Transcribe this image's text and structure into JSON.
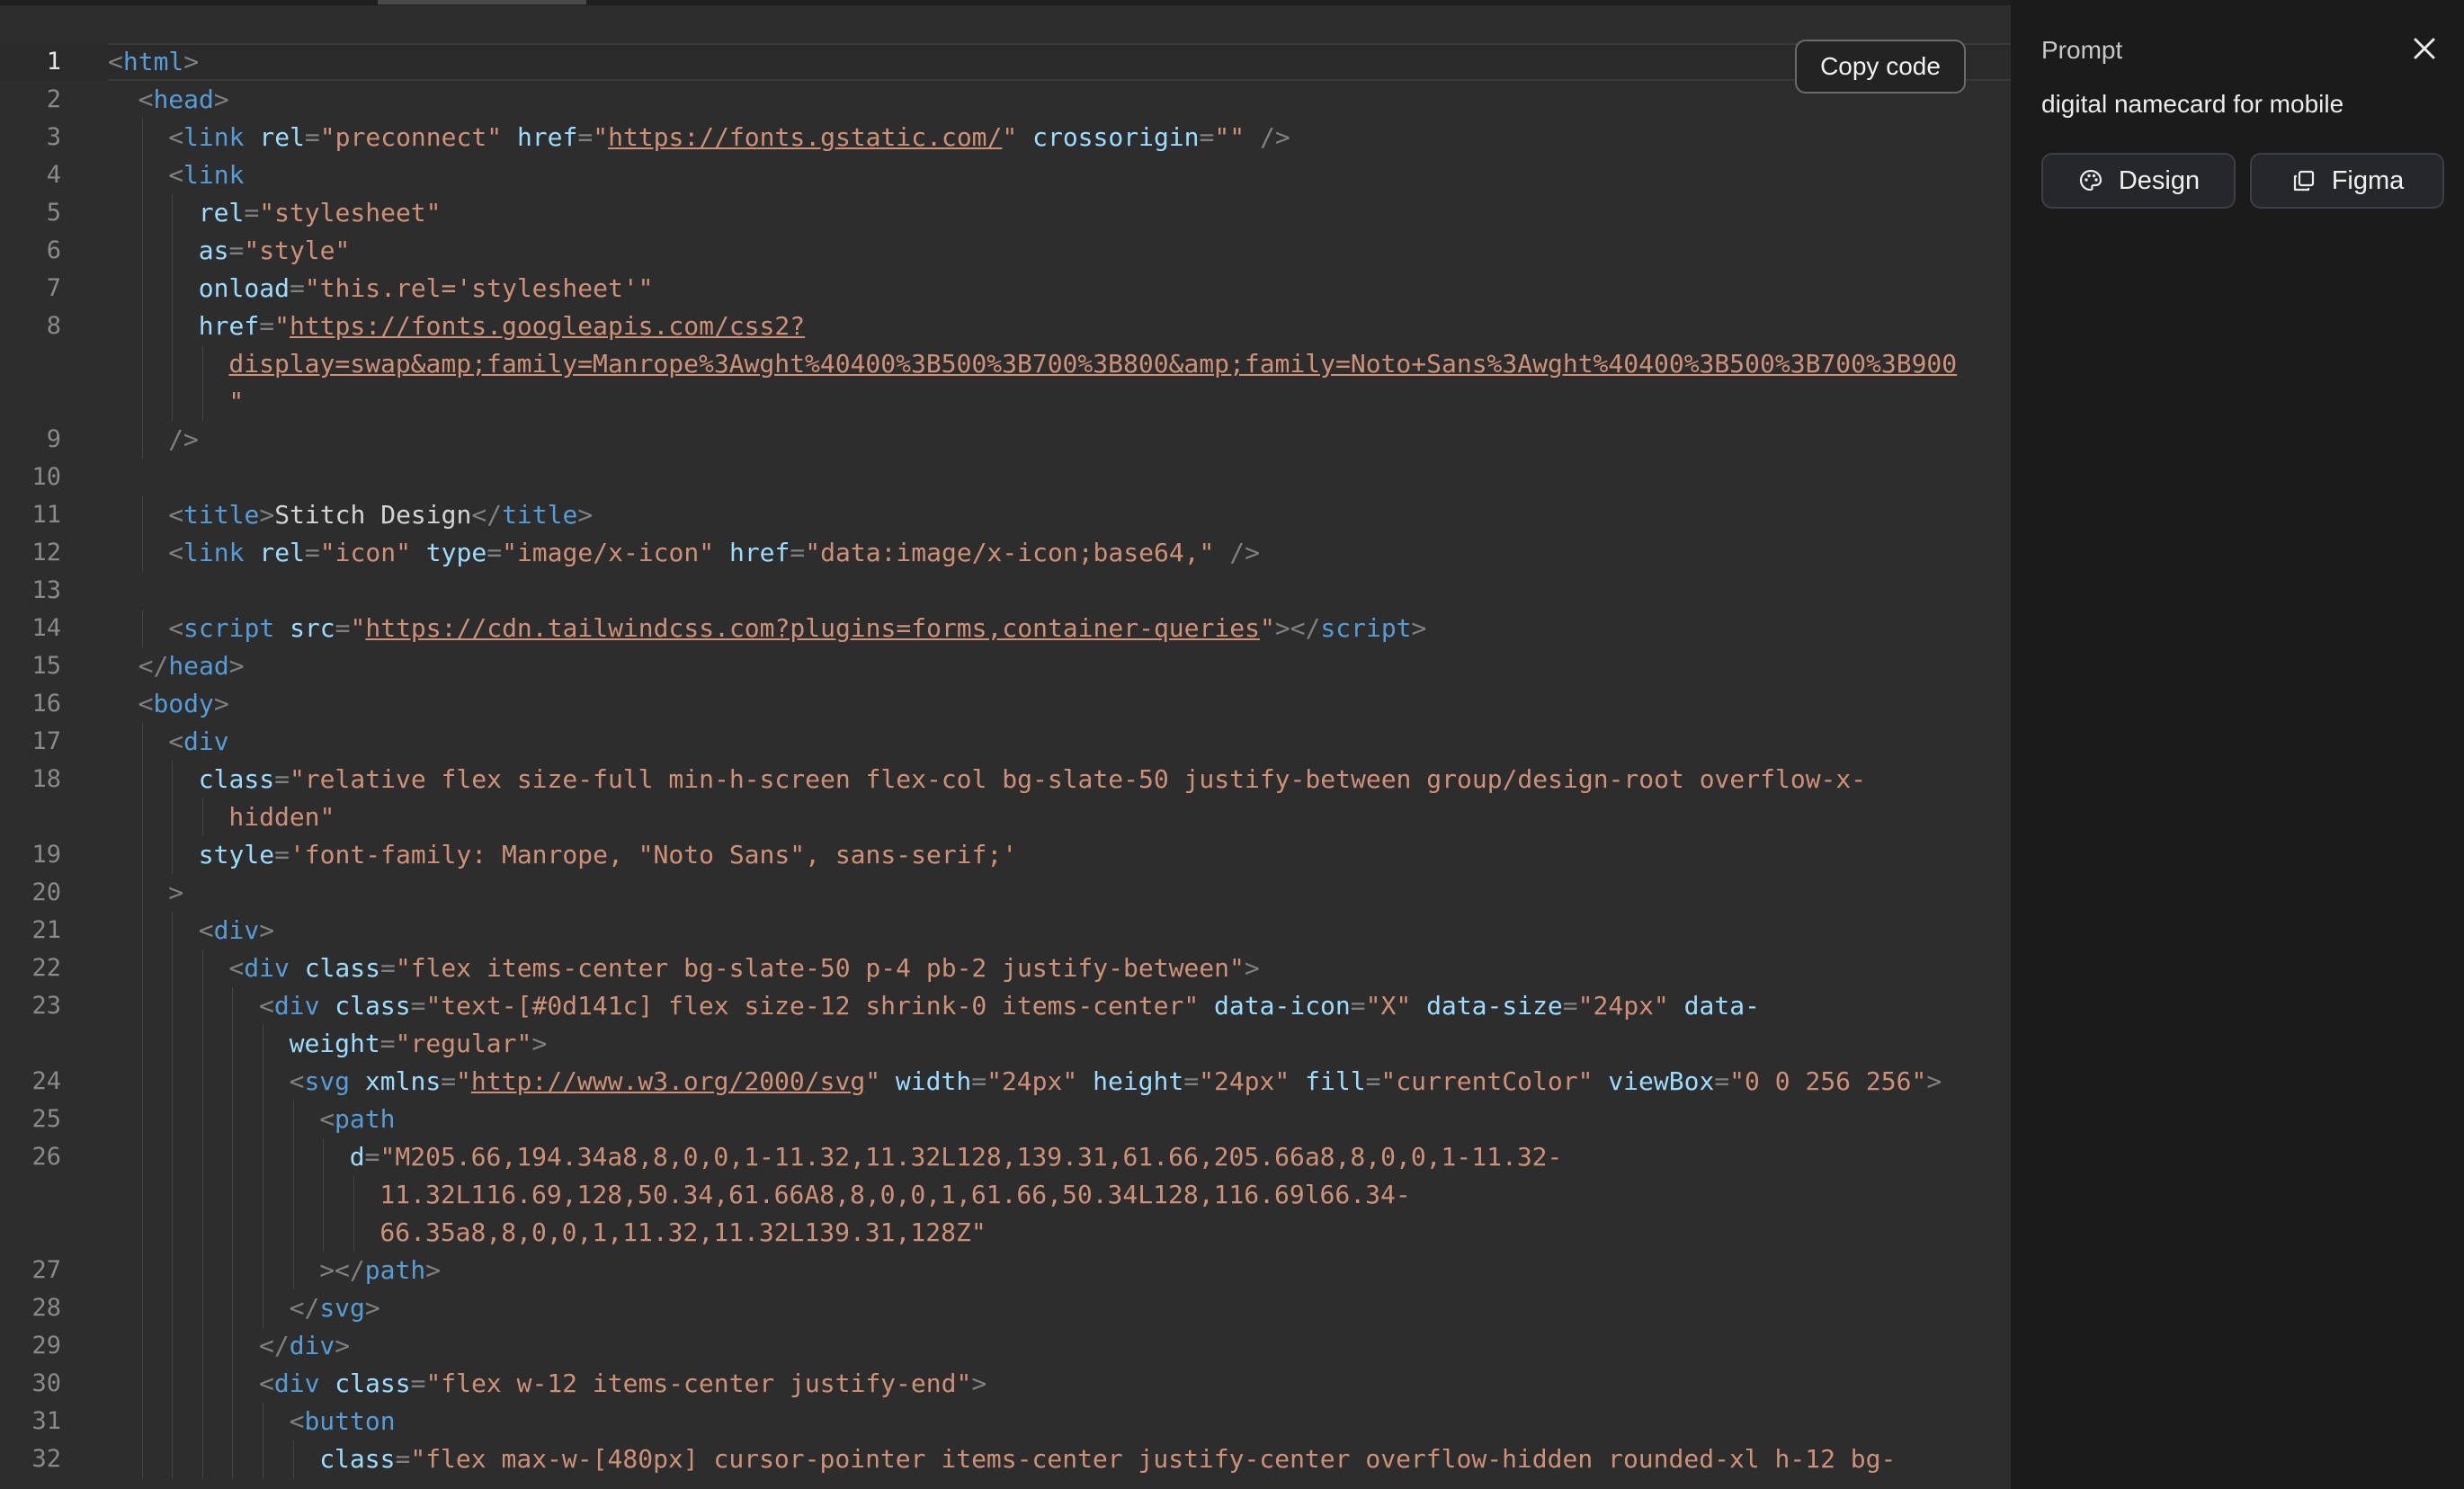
{
  "editor": {
    "copy_label": "Copy code",
    "active_line": 1,
    "lines": [
      {
        "n": "1",
        "indent": 0,
        "t": [
          [
            "tag",
            "<"
          ],
          [
            "name",
            "html"
          ],
          [
            "tag",
            ">"
          ]
        ]
      },
      {
        "n": "2",
        "indent": 1,
        "t": [
          [
            "tag",
            "<"
          ],
          [
            "name",
            "head"
          ],
          [
            "tag",
            ">"
          ]
        ]
      },
      {
        "n": "3",
        "indent": 2,
        "t": [
          [
            "tag",
            "<"
          ],
          [
            "name",
            "link"
          ],
          [
            "p",
            " "
          ],
          [
            "attr",
            "rel"
          ],
          [
            "tag",
            "="
          ],
          [
            "str",
            "\"preconnect\""
          ],
          [
            "p",
            " "
          ],
          [
            "attr",
            "href"
          ],
          [
            "tag",
            "="
          ],
          [
            "str",
            "\""
          ],
          [
            "url",
            "https://fonts.gstatic.com/"
          ],
          [
            "str",
            "\""
          ],
          [
            "p",
            " "
          ],
          [
            "attr",
            "crossorigin"
          ],
          [
            "tag",
            "="
          ],
          [
            "str",
            "\"\""
          ],
          [
            "p",
            " "
          ],
          [
            "tag",
            "/>"
          ]
        ]
      },
      {
        "n": "4",
        "indent": 2,
        "t": [
          [
            "tag",
            "<"
          ],
          [
            "name",
            "link"
          ]
        ]
      },
      {
        "n": "5",
        "indent": 3,
        "t": [
          [
            "attr",
            "rel"
          ],
          [
            "tag",
            "="
          ],
          [
            "str",
            "\"stylesheet\""
          ]
        ]
      },
      {
        "n": "6",
        "indent": 3,
        "t": [
          [
            "attr",
            "as"
          ],
          [
            "tag",
            "="
          ],
          [
            "str",
            "\"style\""
          ]
        ]
      },
      {
        "n": "7",
        "indent": 3,
        "t": [
          [
            "attr",
            "onload"
          ],
          [
            "tag",
            "="
          ],
          [
            "str",
            "\"this.rel='stylesheet'\""
          ]
        ]
      },
      {
        "n": "8",
        "indent": 3,
        "t": [
          [
            "attr",
            "href"
          ],
          [
            "tag",
            "="
          ],
          [
            "str",
            "\""
          ],
          [
            "url",
            "https://fonts.googleapis.com/css2?"
          ]
        ]
      },
      {
        "n": "",
        "indent": 4,
        "t": [
          [
            "url",
            "display=swap&amp;family=Manrope%3Awght%40400%3B500%3B700%3B800&amp;family=Noto+Sans%3Awght%40400%3B500%3B700%3B900"
          ]
        ]
      },
      {
        "n": "",
        "indent": 4,
        "t": [
          [
            "str",
            "\""
          ]
        ]
      },
      {
        "n": "9",
        "indent": 2,
        "t": [
          [
            "tag",
            "/>"
          ]
        ]
      },
      {
        "n": "10",
        "indent": 0,
        "t": []
      },
      {
        "n": "11",
        "indent": 2,
        "t": [
          [
            "tag",
            "<"
          ],
          [
            "name",
            "title"
          ],
          [
            "tag",
            ">"
          ],
          [
            "text",
            "Stitch Design"
          ],
          [
            "tag",
            "</"
          ],
          [
            "name",
            "title"
          ],
          [
            "tag",
            ">"
          ]
        ]
      },
      {
        "n": "12",
        "indent": 2,
        "t": [
          [
            "tag",
            "<"
          ],
          [
            "name",
            "link"
          ],
          [
            "p",
            " "
          ],
          [
            "attr",
            "rel"
          ],
          [
            "tag",
            "="
          ],
          [
            "str",
            "\"icon\""
          ],
          [
            "p",
            " "
          ],
          [
            "attr",
            "type"
          ],
          [
            "tag",
            "="
          ],
          [
            "str",
            "\"image/x-icon\""
          ],
          [
            "p",
            " "
          ],
          [
            "attr",
            "href"
          ],
          [
            "tag",
            "="
          ],
          [
            "str",
            "\"data:image/x-icon;base64,\""
          ],
          [
            "p",
            " "
          ],
          [
            "tag",
            "/>"
          ]
        ]
      },
      {
        "n": "13",
        "indent": 0,
        "t": []
      },
      {
        "n": "14",
        "indent": 2,
        "t": [
          [
            "tag",
            "<"
          ],
          [
            "name",
            "script"
          ],
          [
            "p",
            " "
          ],
          [
            "attr",
            "src"
          ],
          [
            "tag",
            "="
          ],
          [
            "str",
            "\""
          ],
          [
            "url",
            "https://cdn.tailwindcss.com?plugins=forms,container-queries"
          ],
          [
            "str",
            "\""
          ],
          [
            "tag",
            "></"
          ],
          [
            "name",
            "script"
          ],
          [
            "tag",
            ">"
          ]
        ]
      },
      {
        "n": "15",
        "indent": 1,
        "t": [
          [
            "tag",
            "</"
          ],
          [
            "name",
            "head"
          ],
          [
            "tag",
            ">"
          ]
        ]
      },
      {
        "n": "16",
        "indent": 1,
        "t": [
          [
            "tag",
            "<"
          ],
          [
            "name",
            "body"
          ],
          [
            "tag",
            ">"
          ]
        ]
      },
      {
        "n": "17",
        "indent": 2,
        "t": [
          [
            "tag",
            "<"
          ],
          [
            "name",
            "div"
          ]
        ]
      },
      {
        "n": "18",
        "indent": 3,
        "t": [
          [
            "attr",
            "class"
          ],
          [
            "tag",
            "="
          ],
          [
            "str",
            "\"relative flex size-full min-h-screen flex-col bg-slate-50 justify-between group/design-root overflow-x-"
          ]
        ]
      },
      {
        "n": "",
        "indent": 4,
        "t": [
          [
            "str",
            "hidden\""
          ]
        ]
      },
      {
        "n": "19",
        "indent": 3,
        "t": [
          [
            "attr",
            "style"
          ],
          [
            "tag",
            "="
          ],
          [
            "str",
            "'font-family: Manrope, \"Noto Sans\", sans-serif;'"
          ]
        ]
      },
      {
        "n": "20",
        "indent": 2,
        "t": [
          [
            "tag",
            ">"
          ]
        ]
      },
      {
        "n": "21",
        "indent": 3,
        "t": [
          [
            "tag",
            "<"
          ],
          [
            "name",
            "div"
          ],
          [
            "tag",
            ">"
          ]
        ]
      },
      {
        "n": "22",
        "indent": 4,
        "t": [
          [
            "tag",
            "<"
          ],
          [
            "name",
            "div"
          ],
          [
            "p",
            " "
          ],
          [
            "attr",
            "class"
          ],
          [
            "tag",
            "="
          ],
          [
            "str",
            "\"flex items-center bg-slate-50 p-4 pb-2 justify-between\""
          ],
          [
            "tag",
            ">"
          ]
        ]
      },
      {
        "n": "23",
        "indent": 5,
        "t": [
          [
            "tag",
            "<"
          ],
          [
            "name",
            "div"
          ],
          [
            "p",
            " "
          ],
          [
            "attr",
            "class"
          ],
          [
            "tag",
            "="
          ],
          [
            "str",
            "\"text-[#0d141c] flex size-12 shrink-0 items-center\""
          ],
          [
            "p",
            " "
          ],
          [
            "attr",
            "data-icon"
          ],
          [
            "tag",
            "="
          ],
          [
            "str",
            "\"X\""
          ],
          [
            "p",
            " "
          ],
          [
            "attr",
            "data-size"
          ],
          [
            "tag",
            "="
          ],
          [
            "str",
            "\"24px\""
          ],
          [
            "p",
            " "
          ],
          [
            "attr",
            "data-"
          ]
        ]
      },
      {
        "n": "",
        "indent": 6,
        "t": [
          [
            "attr",
            "weight"
          ],
          [
            "tag",
            "="
          ],
          [
            "str",
            "\"regular\""
          ],
          [
            "tag",
            ">"
          ]
        ]
      },
      {
        "n": "24",
        "indent": 6,
        "t": [
          [
            "tag",
            "<"
          ],
          [
            "name",
            "svg"
          ],
          [
            "p",
            " "
          ],
          [
            "attr",
            "xmlns"
          ],
          [
            "tag",
            "="
          ],
          [
            "str",
            "\""
          ],
          [
            "url",
            "http://www.w3.org/2000/svg"
          ],
          [
            "str",
            "\""
          ],
          [
            "p",
            " "
          ],
          [
            "attr",
            "width"
          ],
          [
            "tag",
            "="
          ],
          [
            "str",
            "\"24px\""
          ],
          [
            "p",
            " "
          ],
          [
            "attr",
            "height"
          ],
          [
            "tag",
            "="
          ],
          [
            "str",
            "\"24px\""
          ],
          [
            "p",
            " "
          ],
          [
            "attr",
            "fill"
          ],
          [
            "tag",
            "="
          ],
          [
            "str",
            "\"currentColor\""
          ],
          [
            "p",
            " "
          ],
          [
            "attr",
            "viewBox"
          ],
          [
            "tag",
            "="
          ],
          [
            "str",
            "\"0 0 256 256\""
          ],
          [
            "tag",
            ">"
          ]
        ]
      },
      {
        "n": "25",
        "indent": 7,
        "t": [
          [
            "tag",
            "<"
          ],
          [
            "name",
            "path"
          ]
        ]
      },
      {
        "n": "26",
        "indent": 8,
        "t": [
          [
            "attr",
            "d"
          ],
          [
            "tag",
            "="
          ],
          [
            "str",
            "\"M205.66,194.34a8,8,0,0,1-11.32,11.32L128,139.31,61.66,205.66a8,8,0,0,1-11.32-"
          ]
        ]
      },
      {
        "n": "",
        "indent": 9,
        "t": [
          [
            "str",
            "11.32L116.69,128,50.34,61.66A8,8,0,0,1,61.66,50.34L128,116.69l66.34-"
          ]
        ]
      },
      {
        "n": "",
        "indent": 9,
        "t": [
          [
            "str",
            "66.35a8,8,0,0,1,11.32,11.32L139.31,128Z\""
          ]
        ]
      },
      {
        "n": "27",
        "indent": 7,
        "t": [
          [
            "tag",
            "></"
          ],
          [
            "name",
            "path"
          ],
          [
            "tag",
            ">"
          ]
        ]
      },
      {
        "n": "28",
        "indent": 6,
        "t": [
          [
            "tag",
            "</"
          ],
          [
            "name",
            "svg"
          ],
          [
            "tag",
            ">"
          ]
        ]
      },
      {
        "n": "29",
        "indent": 5,
        "t": [
          [
            "tag",
            "</"
          ],
          [
            "name",
            "div"
          ],
          [
            "tag",
            ">"
          ]
        ]
      },
      {
        "n": "30",
        "indent": 5,
        "t": [
          [
            "tag",
            "<"
          ],
          [
            "name",
            "div"
          ],
          [
            "p",
            " "
          ],
          [
            "attr",
            "class"
          ],
          [
            "tag",
            "="
          ],
          [
            "str",
            "\"flex w-12 items-center justify-end\""
          ],
          [
            "tag",
            ">"
          ]
        ]
      },
      {
        "n": "31",
        "indent": 6,
        "t": [
          [
            "tag",
            "<"
          ],
          [
            "name",
            "button"
          ]
        ]
      },
      {
        "n": "32",
        "indent": 7,
        "t": [
          [
            "attr",
            "class"
          ],
          [
            "tag",
            "="
          ],
          [
            "str",
            "\"flex max-w-[480px] cursor-pointer items-center justify-center overflow-hidden rounded-xl h-12 bg-"
          ]
        ]
      }
    ]
  },
  "panel": {
    "title": "Prompt",
    "prompt_text": "digital namecard for mobile",
    "buttons": [
      {
        "label": "Design",
        "icon": "palette-icon"
      },
      {
        "label": "Figma",
        "icon": "copy-icon"
      }
    ]
  },
  "colors": {
    "tag": "#808080",
    "name": "#569cd6",
    "attr": "#9cdcfe",
    "str": "#ce9178",
    "url": "#ce9178",
    "text": "#d4d4d4",
    "p": "#d4d4d4"
  }
}
